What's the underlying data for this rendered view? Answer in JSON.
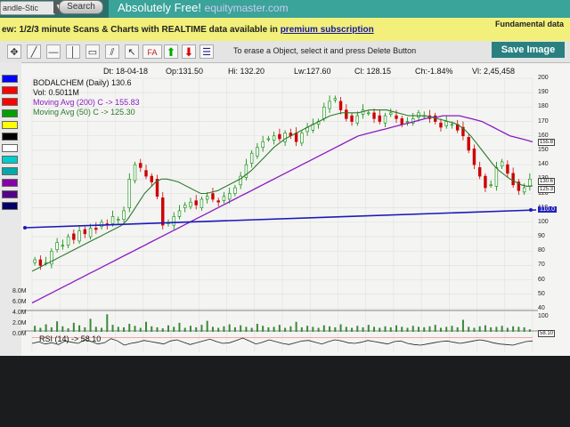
{
  "header": {
    "style_select": "andle-Stic",
    "search_label": "Search",
    "banner_text": "Absolutely Free!",
    "banner_brand": "equitymaster.com"
  },
  "promo": {
    "text_before": "ew: 1/2/3 minute Scans & Charts with REALTIME data available in",
    "link": "premium subscription",
    "fundamental": "Fundamental data"
  },
  "toolbar": {
    "hint": "To erase a Object, select it and press Delete Button",
    "save_label": "Save Image",
    "fib_label": "FA"
  },
  "palette_colors": [
    "#0000ff",
    "#ff0000",
    "#ff0000",
    "#00a000",
    "#ffff00",
    "#000000",
    "#ffffff",
    "#00cccc",
    "#00aaaa",
    "#8800aa",
    "#550088",
    "#000066"
  ],
  "quote": {
    "date": "Dt: 18-04-18",
    "open": "Op:131.50",
    "high": "Hi: 132.20",
    "low": "Lw:127.60",
    "close": "Cl: 128.15",
    "change": "Ch:-1.84%",
    "volume": "Vl: 2,45,458"
  },
  "legend": {
    "symbol": "BODALCHEM (Daily) 130.6",
    "vol": "Vol: 0.5011M",
    "ma200": "Moving Avg (200) C -> 155.83",
    "ma50": "Moving Avg (50) C -> 125.30",
    "rsi": "RSI (14) -> 58.10"
  },
  "price_ticks": [
    "200",
    "190",
    "180",
    "170",
    "160",
    "150",
    "140",
    "130",
    "120",
    "110",
    "100",
    "90",
    "80",
    "70",
    "60",
    "50",
    "40"
  ],
  "volume_ticks": [
    "8.0M",
    "6.0M",
    "4.0M",
    "2.0M",
    "0.0M"
  ],
  "badges": {
    "ma200": "155.8",
    "last": "130.6",
    "ma50": "125.3",
    "trendline": "110.0",
    "rsi": "58.10",
    "vol_axis": "100"
  },
  "colors": {
    "candle_up": "#008800",
    "candle_down": "#cc0000",
    "ma200": "#8a1ac0",
    "ma50": "#2c7a2c",
    "trendline": "#1a1ab8",
    "volume": "#3a8a3a"
  },
  "chart_data": {
    "type": "line",
    "price_ylim": [
      40,
      200
    ],
    "close_series": [
      74,
      70,
      72,
      80,
      86,
      84,
      90,
      88,
      94,
      92,
      96,
      95,
      100,
      98,
      104,
      102,
      108,
      130,
      140,
      138,
      132,
      128,
      118,
      98,
      100,
      104,
      108,
      112,
      114,
      112,
      116,
      118,
      116,
      114,
      118,
      120,
      124,
      132,
      140,
      148,
      152,
      156,
      158,
      160,
      158,
      162,
      160,
      156,
      162,
      166,
      168,
      170,
      180,
      184,
      186,
      178,
      172,
      170,
      174,
      178,
      176,
      172,
      170,
      174,
      176,
      172,
      168,
      170,
      172,
      176,
      174,
      172,
      170,
      166,
      170,
      168,
      164,
      160,
      150,
      140,
      132,
      124,
      126,
      138,
      142,
      134,
      126,
      122,
      124,
      130
    ],
    "ma50_series": [
      66,
      68,
      70,
      72,
      74,
      76,
      78,
      80,
      82,
      84,
      86,
      88,
      90,
      92,
      94,
      96,
      98,
      102,
      108,
      114,
      120,
      124,
      128,
      130,
      130,
      129,
      128,
      126,
      124,
      122,
      120,
      120,
      121,
      122,
      124,
      126,
      128,
      130,
      133,
      136,
      140,
      144,
      148,
      152,
      155,
      158,
      160,
      162,
      164,
      166,
      168,
      170,
      172,
      174,
      175,
      176,
      176,
      176,
      176,
      177,
      178,
      178,
      178,
      178,
      177,
      176,
      175,
      174,
      174,
      174,
      174,
      173,
      172,
      171,
      170,
      169,
      167,
      164,
      160,
      155,
      150,
      145,
      140,
      136,
      133,
      130,
      128,
      126,
      125,
      125.3
    ],
    "ma200_series": [
      44,
      46,
      48,
      50,
      52,
      54,
      56,
      58,
      60,
      62,
      64,
      66,
      68,
      70,
      72,
      74,
      76,
      78,
      80,
      82,
      84,
      86,
      88,
      90,
      92,
      94,
      96,
      98,
      100,
      102,
      104,
      106,
      108,
      110,
      112,
      114,
      116,
      118,
      120,
      122,
      124,
      126,
      128,
      130,
      132,
      134,
      136,
      138,
      140,
      142,
      144,
      146,
      148,
      150,
      152,
      154,
      156,
      158,
      160,
      161,
      162,
      163,
      164,
      165,
      166,
      167,
      168,
      169,
      170,
      171,
      172,
      173,
      173,
      174,
      174,
      174,
      174,
      173,
      172,
      171,
      170,
      168,
      166,
      164,
      162,
      160,
      159,
      158,
      157,
      155.83
    ],
    "trendline": [
      110,
      110
    ],
    "rsi_series": [
      50,
      55,
      48,
      52,
      46,
      58,
      54,
      50,
      62,
      56,
      48,
      52,
      66,
      58,
      44,
      50,
      54,
      60,
      56,
      52,
      48,
      58,
      62,
      54,
      46,
      52,
      58,
      64,
      56,
      50,
      52,
      60,
      68,
      58,
      48,
      54,
      62,
      56,
      50,
      46,
      52,
      58,
      60,
      54,
      48,
      56,
      62,
      58,
      52,
      50,
      54,
      60,
      56,
      52,
      48,
      56,
      58,
      50,
      46,
      44,
      48,
      52,
      56,
      58,
      54,
      50,
      54,
      58,
      62,
      58,
      52,
      48,
      46,
      44,
      50,
      56,
      58.1
    ],
    "volume_series": [
      1.2,
      0.8,
      1.5,
      0.9,
      2.1,
      1.1,
      0.7,
      1.8,
      1.3,
      0.9,
      2.6,
      1.0,
      0.8,
      3.5,
      1.4,
      1.0,
      0.9,
      1.6,
      1.2,
      0.8,
      2.0,
      1.1,
      0.9,
      0.7,
      1.3,
      1.0,
      1.8,
      0.8,
      1.2,
      0.9,
      1.4,
      2.2,
      1.0,
      0.8,
      1.1,
      1.5,
      0.9,
      1.3,
      1.0,
      0.8,
      1.6,
      1.2,
      0.9,
      1.0,
      1.4,
      0.8,
      1.1,
      2.0,
      0.9,
      1.2,
      1.0,
      0.8,
      1.3,
      1.1,
      0.9,
      1.5,
      1.0,
      0.8,
      1.2,
      0.9,
      1.4,
      1.0,
      0.8,
      1.1,
      0.9,
      1.3,
      1.0,
      0.8,
      1.2,
      1.0,
      0.9,
      1.1,
      1.4,
      0.8,
      1.0,
      1.2,
      0.9,
      2.4,
      1.0,
      0.8,
      1.1,
      1.3,
      0.9,
      1.0,
      1.2,
      0.8,
      1.1,
      1.0,
      0.9,
      0.5
    ],
    "volume_ylim": [
      0,
      8
    ]
  }
}
